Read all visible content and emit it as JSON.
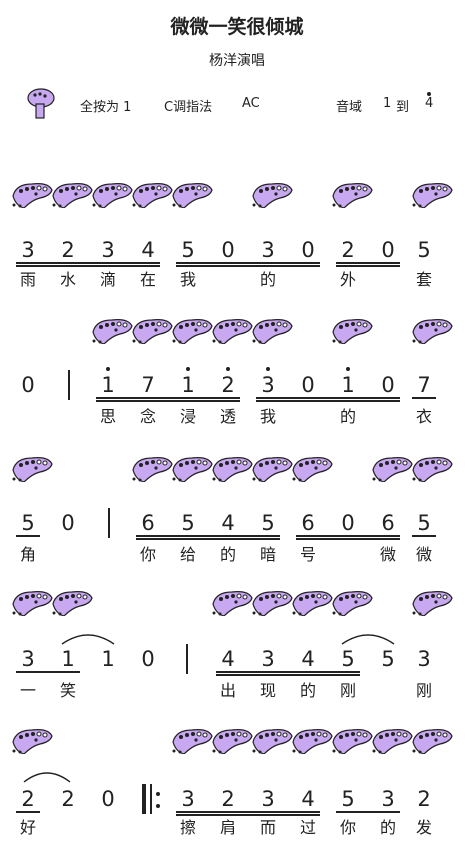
{
  "header": {
    "title": "微微一笑很倾城",
    "subtitle": "杨洋演唱",
    "fingering_all": "全按为 1",
    "fingering_method": "C调指法",
    "ocarina_type": "AC",
    "range_label": "音域",
    "range_low": "1",
    "range_to": "到",
    "range_high": "4"
  },
  "colors": {
    "ocarina_fill": "#c9a8f2",
    "ocarina_outline": "#222222"
  },
  "lines": [
    {
      "notes": [
        "3",
        "2",
        "3",
        "4",
        "5",
        "0",
        "3",
        "0",
        "2",
        "0",
        "5"
      ],
      "lyrics": [
        "雨",
        "水",
        "滴",
        "在",
        "我",
        "的",
        "外",
        "套"
      ]
    },
    {
      "notes": [
        "0",
        "1",
        "7",
        "1",
        "2",
        "3",
        "0",
        "1",
        "0",
        "7"
      ],
      "lyrics": [
        "思",
        "念",
        "浸",
        "透",
        "我",
        "的",
        "衣"
      ]
    },
    {
      "notes": [
        "5",
        "0",
        "6",
        "5",
        "4",
        "5",
        "6",
        "0",
        "6",
        "5"
      ],
      "lyrics": [
        "角",
        "你",
        "给",
        "的",
        "暗",
        "号",
        "微",
        "微"
      ]
    },
    {
      "notes": [
        "3",
        "1",
        "1",
        "0",
        "4",
        "3",
        "4",
        "5",
        "5",
        "3"
      ],
      "lyrics": [
        "一",
        "笑",
        "出",
        "现",
        "的",
        "刚",
        "刚"
      ]
    },
    {
      "notes": [
        "2",
        "2",
        "0",
        "3",
        "2",
        "3",
        "4",
        "5",
        "3",
        "2"
      ],
      "lyrics": [
        "好",
        "擦",
        "肩",
        "而",
        "过",
        "你",
        "的",
        "发"
      ]
    }
  ]
}
